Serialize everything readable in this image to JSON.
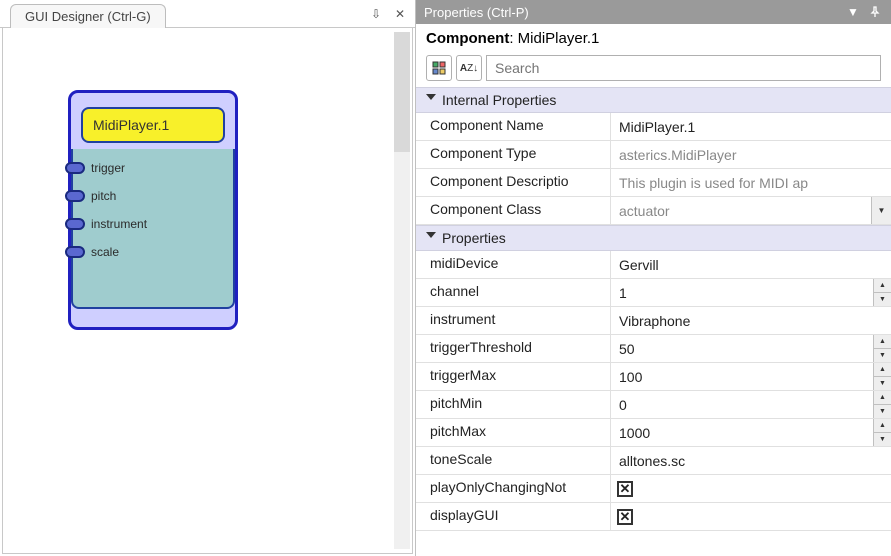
{
  "designer": {
    "tab_title": "GUI Designer (Ctrl-G)",
    "component_title": "MidiPlayer.1",
    "ports": [
      "trigger",
      "pitch",
      "instrument",
      "scale"
    ]
  },
  "properties": {
    "panel_title": "Properties (Ctrl-P)",
    "component_label_prefix": "Component",
    "component_label_value": "MidiPlayer.1",
    "search": {
      "placeholder": "Search"
    },
    "icons": {
      "categorized": "categorized-icon",
      "alpha_sort": "A↓",
      "undock": "⇩",
      "close": "✕",
      "dropdown": "▼",
      "pin": "📌"
    },
    "groups": [
      {
        "name": "Internal Properties",
        "rows": [
          {
            "label": "Component Name",
            "value": "MidiPlayer.1",
            "kind": "text"
          },
          {
            "label": "Component Type",
            "value": "asterics.MidiPlayer",
            "kind": "readonly"
          },
          {
            "label": "Component Description",
            "value": "This plugin is used for MIDI applications",
            "kind": "readonly"
          },
          {
            "label": "Component Class",
            "value": "actuator",
            "kind": "combo-readonly"
          }
        ]
      },
      {
        "name": "Properties",
        "rows": [
          {
            "label": "midiDevice",
            "value": "Gervill",
            "kind": "text"
          },
          {
            "label": "channel",
            "value": "1",
            "kind": "spinner"
          },
          {
            "label": "instrument",
            "value": "Vibraphone",
            "kind": "text"
          },
          {
            "label": "triggerThreshold",
            "value": "50",
            "kind": "spinner"
          },
          {
            "label": "triggerMax",
            "value": "100",
            "kind": "spinner"
          },
          {
            "label": "pitchMin",
            "value": "0",
            "kind": "spinner"
          },
          {
            "label": "pitchMax",
            "value": "1000",
            "kind": "spinner"
          },
          {
            "label": "toneScale",
            "value": "alltones.sc",
            "kind": "text"
          },
          {
            "label": "playOnlyChangingNotes",
            "value": "true",
            "kind": "check"
          },
          {
            "label": "displayGUI",
            "value": "true",
            "kind": "check"
          }
        ]
      }
    ]
  }
}
